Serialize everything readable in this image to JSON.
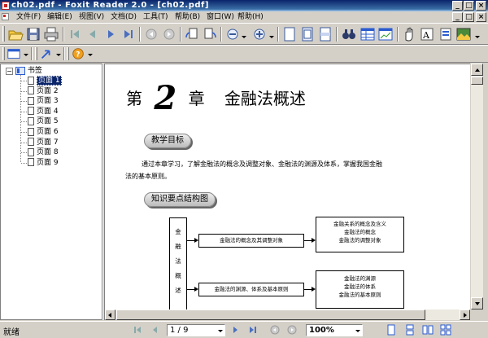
{
  "window": {
    "title": "ch02.pdf - Foxit Reader 2.0 - [ch02.pdf]",
    "controls": [
      "_",
      "□",
      "×"
    ],
    "mdi_controls": [
      "_",
      "□",
      "×"
    ]
  },
  "menu": [
    "文件(F)",
    "编辑(E)",
    "视图(V)",
    "文档(D)",
    "工具(T)",
    "帮助(B)",
    "窗口(W)",
    "帮助(H)"
  ],
  "sidebar": {
    "root_label": "书签",
    "items": [
      "页面 1",
      "页面 2",
      "页面 3",
      "页面 4",
      "页面 5",
      "页面 6",
      "页面 7",
      "页面 8",
      "页面 9"
    ],
    "selected_index": 0
  },
  "document": {
    "chapter_prefix": "第",
    "chapter_number": "2",
    "chapter_suffix": "章",
    "chapter_title": "金融法概述",
    "section1": "教学目标",
    "intro_line1": "通过本章学习，了解金融法的概念及调整对象、金融法的渊源及体系，掌握我国金融",
    "intro_line2": "法的基本原则。",
    "section2": "知识要点结构图",
    "diagram": {
      "vertical_chars": [
        "金",
        "融",
        "法",
        "概",
        "述"
      ],
      "branch1": "金融法的概念及其调整对象",
      "branch1_details": [
        "金融关系的概念及含义",
        "金融法的概念",
        "金融法的调整对象"
      ],
      "branch2": "金融法的渊源、体系及基本原则",
      "branch2_details": [
        "金融法的渊源",
        "金融法的体系",
        "金融法的基本原则"
      ]
    }
  },
  "statusbar": {
    "status": "就绪",
    "page_indicator": "1 / 9",
    "zoom": "100%"
  },
  "colors": {
    "titlebar": "#0a246a",
    "selection": "#0a246a",
    "chrome": "#d4d0c8"
  }
}
